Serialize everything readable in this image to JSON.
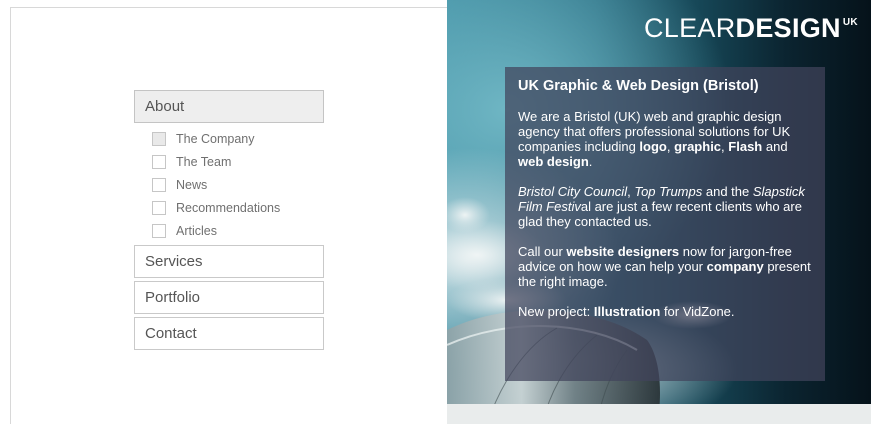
{
  "nav": {
    "about": "About",
    "sub_items": [
      {
        "label": "The Company",
        "checked": true
      },
      {
        "label": "The Team",
        "checked": false
      },
      {
        "label": "News",
        "checked": false
      },
      {
        "label": "Recommendations",
        "checked": false
      },
      {
        "label": "Articles",
        "checked": false
      }
    ],
    "services": "Services",
    "portfolio": "Portfolio",
    "contact": "Contact"
  },
  "logo": {
    "light": "CLEAR",
    "bold": "DESIGN",
    "sup": "UK"
  },
  "info": {
    "heading": "UK Graphic & Web Design (Bristol)",
    "p1": {
      "t1": "We are a Bristol (UK) web and graphic design agency that offers professional solutions for UK companies including ",
      "logo": "logo",
      "t2": ", ",
      "graphic": "graphic",
      "t3": ", ",
      "flash": "Flash",
      "t4": " and ",
      "webdesign": "web design",
      "t5": "."
    },
    "p2": {
      "council": "Bristol City Council",
      "t1": ", ",
      "trumps": "Top Trumps",
      "t2": " and the ",
      "festival": "Slapstick Film Festiv",
      "t3": "al are just a few recent clients who are glad they contacted us."
    },
    "p3": {
      "t1": "Call our ",
      "designers": "website designers",
      "t2": " now for jargon-free advice on how we can help your ",
      "company": "company",
      "t3": " present the right image."
    },
    "p4": {
      "t1": "New project: ",
      "illustration": "Illustration",
      "t2": " for VidZone."
    }
  },
  "colors": {
    "panel": "#41445c",
    "nav_border": "#c9c9c9",
    "nav_text": "#555555"
  }
}
